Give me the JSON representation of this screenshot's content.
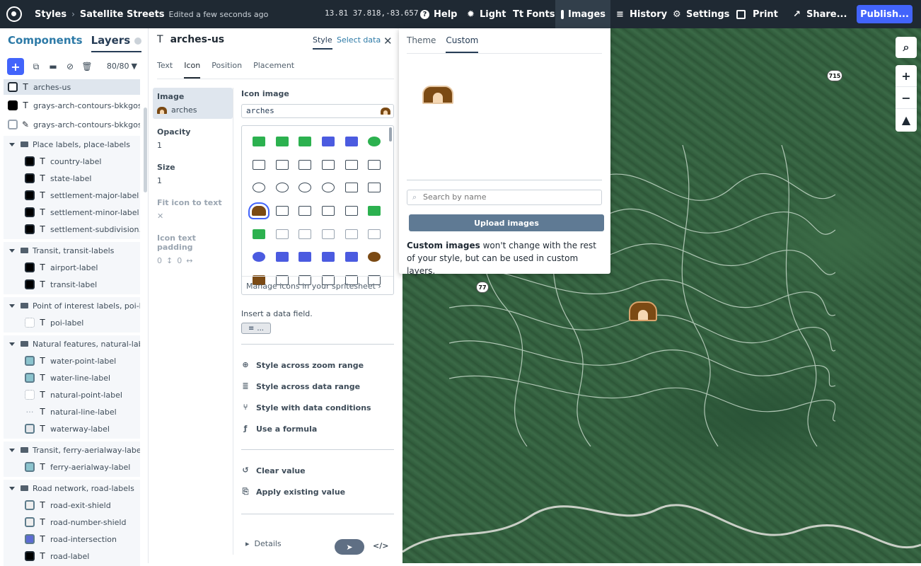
{
  "topbar": {
    "styles_label": "Styles",
    "style_name": "Satellite Streets",
    "edited": "Edited a few seconds ago",
    "coords": "13.81  37.818,-83.657",
    "items": [
      {
        "label": "Help",
        "icon": "question-icon"
      },
      {
        "label": "Light",
        "icon": "sun-icon"
      },
      {
        "label": "Fonts",
        "icon": "font-icon"
      },
      {
        "label": "Images",
        "icon": "image-icon"
      },
      {
        "label": "History",
        "icon": "history-icon"
      },
      {
        "label": "Settings",
        "icon": "gear-icon"
      },
      {
        "label": "Print",
        "icon": "print-icon"
      },
      {
        "label": "Share...",
        "icon": "share-icon"
      }
    ],
    "publish": "Publish..."
  },
  "left": {
    "tab_components": "Components",
    "tab_layers": "Layers",
    "count": "80/80",
    "top_layers": [
      {
        "name": "arches-us",
        "type": "T"
      },
      {
        "name": "grays-arch-contours-bkkgos ...",
        "type": "T"
      },
      {
        "name": "grays-arch-contours-bkkgos",
        "type": "✎"
      }
    ],
    "groups": [
      {
        "name": "Place labels, place-labels",
        "layers": [
          "country-label",
          "state-label",
          "settlement-major-label",
          "settlement-minor-label",
          "settlement-subdivision..."
        ]
      },
      {
        "name": "Transit, transit-labels",
        "layers": [
          "airport-label",
          "transit-label"
        ]
      },
      {
        "name": "Point of interest labels, poi-lab...",
        "layers": [
          "poi-label"
        ]
      },
      {
        "name": "Natural features, natural-labels",
        "layers": [
          "water-point-label",
          "water-line-label",
          "natural-point-label",
          "natural-line-label",
          "waterway-label"
        ]
      },
      {
        "name": "Transit, ferry-aerialway-labels",
        "layers": [
          "ferry-aerialway-label"
        ]
      },
      {
        "name": "Road network, road-labels",
        "layers": [
          "road-exit-shield",
          "road-number-shield",
          "road-intersection",
          "road-label"
        ]
      }
    ]
  },
  "mid": {
    "layer_name": "arches-us",
    "tab_style": "Style",
    "tab_select_data": "Select data",
    "subtabs": [
      "Text",
      "Icon",
      "Position",
      "Placement"
    ],
    "props": {
      "image_label": "Image",
      "image_value": "arches",
      "opacity_label": "Opacity",
      "opacity_value": "1",
      "size_label": "Size",
      "size_value": "1",
      "fit_label": "Fit icon to text",
      "fit_value": "✕",
      "padding_label": "Icon text padding",
      "padding_v": "0",
      "padding_h": "0"
    },
    "editor": {
      "title": "Icon image",
      "value": "arches",
      "manage": "Manage icons in your spritesheet",
      "insert": "Insert a data field.",
      "data_field_btn": "...",
      "actions": [
        "Style across zoom range",
        "Style across data range",
        "Style with data conditions",
        "Use a formula"
      ],
      "actions2": [
        "Clear value",
        "Apply existing value"
      ],
      "details": "Details"
    }
  },
  "popover": {
    "tab_theme": "Theme",
    "tab_custom": "Custom",
    "search_placeholder": "Search by name",
    "upload": "Upload images",
    "note_bold": "Custom images",
    "note_rest": " won't change with the rest of your style, but can be used in custom layers."
  },
  "map": {
    "shield_715": "715",
    "shield_77": "77"
  }
}
